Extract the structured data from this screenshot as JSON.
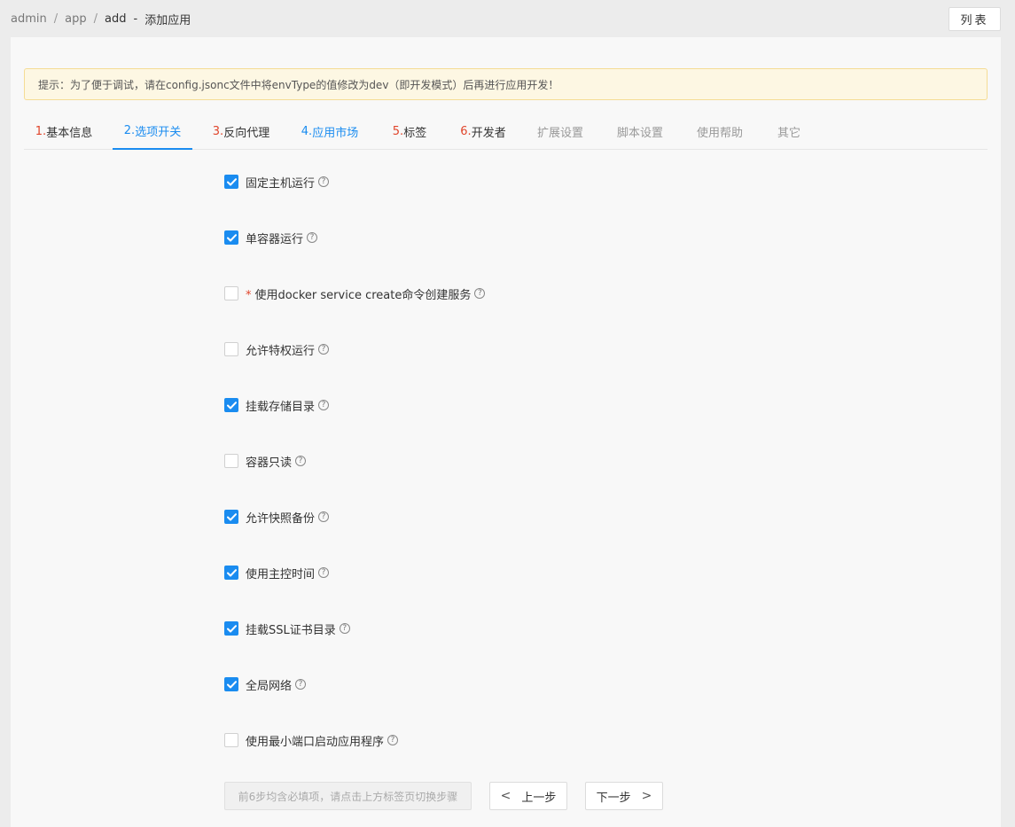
{
  "breadcrumb": {
    "items": [
      "admin",
      "app",
      "add"
    ],
    "separator": "/",
    "dash": "-",
    "page_title": "添加应用"
  },
  "header": {
    "list_button": "列表"
  },
  "tip": {
    "text": "提示：为了便于调试，请在config.jsonc文件中将envType的值修改为dev（即开发模式）后再进行应用开发！"
  },
  "tabs": [
    {
      "num": "1.",
      "label": "基本信息"
    },
    {
      "num": "2.",
      "label": "选项开关"
    },
    {
      "num": "3.",
      "label": "反向代理"
    },
    {
      "num": "4.",
      "label": "应用市场"
    },
    {
      "num": "5.",
      "label": "标签"
    },
    {
      "num": "6.",
      "label": "开发者"
    },
    {
      "label": "扩展设置"
    },
    {
      "label": "脚本设置"
    },
    {
      "label": "使用帮助"
    },
    {
      "label": "其它"
    }
  ],
  "options": [
    {
      "label": "固定主机运行",
      "checked": true
    },
    {
      "label": "单容器运行",
      "checked": true
    },
    {
      "label": "使用docker service create命令创建服务",
      "checked": false,
      "required": "*"
    },
    {
      "label": "允许特权运行",
      "checked": false
    },
    {
      "label": "挂载存储目录",
      "checked": true
    },
    {
      "label": "容器只读",
      "checked": false
    },
    {
      "label": "允许快照备份",
      "checked": true
    },
    {
      "label": "使用主控时间",
      "checked": true
    },
    {
      "label": "挂载SSL证书目录",
      "checked": true
    },
    {
      "label": "全局网络",
      "checked": true
    },
    {
      "label": "使用最小端口启动应用程序",
      "checked": false
    }
  ],
  "help_glyph": "?",
  "footer": {
    "note": "前6步均含必填项，请点击上方标签页切换步骤",
    "prev_label": "上一步",
    "next_label": "下一步",
    "prev_chevron": "<",
    "next_chevron": ">"
  },
  "colors": {
    "accent": "#1a8cf0",
    "required": "#e0452b",
    "tip_bg": "#fdf7e3"
  }
}
